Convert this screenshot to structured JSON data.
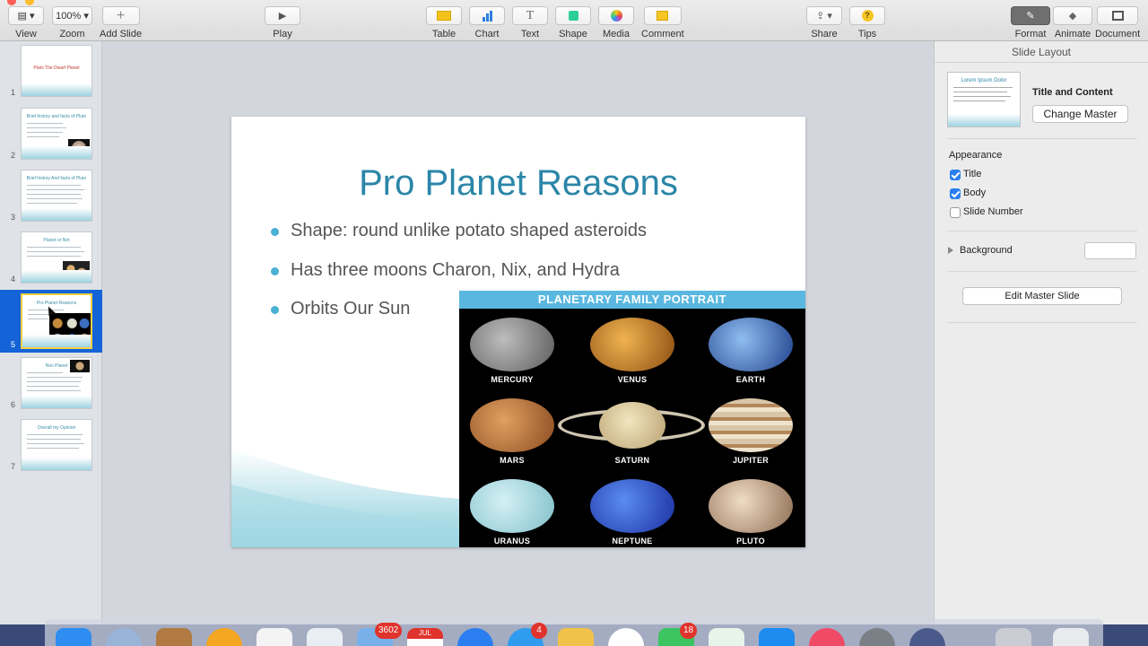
{
  "toolbar": {
    "view": "View",
    "zoom": "Zoom",
    "zoom_value": "100%",
    "add_slide": "Add Slide",
    "play": "Play",
    "table": "Table",
    "chart": "Chart",
    "text": "Text",
    "shape": "Shape",
    "media": "Media",
    "comment": "Comment",
    "share": "Share",
    "tips": "Tips",
    "format": "Format",
    "animate": "Animate",
    "document": "Document"
  },
  "sidebar": {
    "slides": [
      {
        "num": "1",
        "title": "Pluto The Dwarf Planet"
      },
      {
        "num": "2",
        "title": "Brief history and facts of Pluto"
      },
      {
        "num": "3",
        "title": "Brief history And facts of Pluto"
      },
      {
        "num": "4",
        "title": "Planet or Not"
      },
      {
        "num": "5",
        "title": "Pro Planet Reasons"
      },
      {
        "num": "6",
        "title": "Non Planet"
      },
      {
        "num": "7",
        "title": "Overall my Opinion"
      }
    ]
  },
  "slide": {
    "title": "Pro Planet Reasons",
    "bullets": [
      "Shape: round unlike potato shaped asteroids",
      "Has three moons Charon, Nix, and Hydra",
      "Orbits Our Sun"
    ],
    "poster": {
      "header": "PLANETARY FAMILY PORTRAIT",
      "planets": [
        "MERCURY",
        "VENUS",
        "EARTH",
        "MARS",
        "SATURN",
        "JUPITER",
        "URANUS",
        "NEPTUNE",
        "PLUTO"
      ]
    }
  },
  "inspector": {
    "header": "Slide Layout",
    "layout_name": "Title and Content",
    "change_master": "Change Master",
    "appearance": "Appearance",
    "title_check": "Title",
    "body_check": "Body",
    "slide_number_check": "Slide Number",
    "background": "Background",
    "edit_master": "Edit Master Slide",
    "preview_title": "Lorem Ipsum Dolor"
  },
  "dock": {
    "badges": {
      "mail": "3602",
      "calendar": "JUL",
      "messages": "4",
      "facetime": "18"
    }
  }
}
